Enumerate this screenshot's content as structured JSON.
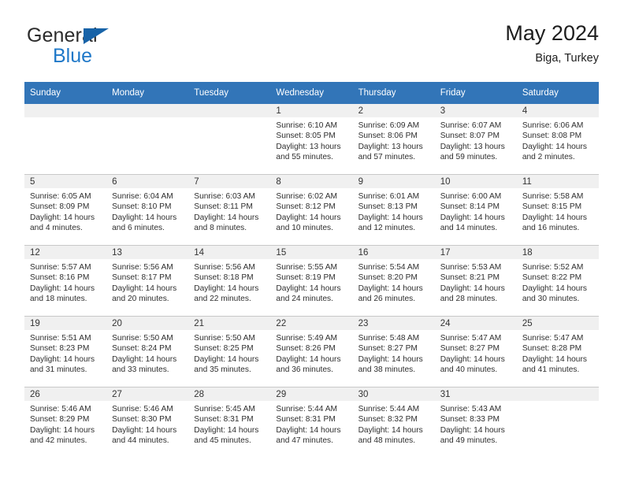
{
  "brand": {
    "name_part1": "General",
    "name_part2": "Blue",
    "triangle_icon": "triangle-icon",
    "color_primary": "#1f78c8",
    "color_triangle": "#1763a8"
  },
  "header": {
    "title": "May 2024",
    "subtitle": "Biga, Turkey"
  },
  "theme": {
    "header_bar_color": "#3275b8",
    "daynum_strip_color": "#f0f0f0",
    "grid_line_color": "#c8c8c8"
  },
  "weekdays": [
    "Sunday",
    "Monday",
    "Tuesday",
    "Wednesday",
    "Thursday",
    "Friday",
    "Saturday"
  ],
  "weeks": [
    [
      {
        "day": "",
        "empty": true
      },
      {
        "day": "",
        "empty": true
      },
      {
        "day": "",
        "empty": true
      },
      {
        "day": "1",
        "sunrise": "Sunrise: 6:10 AM",
        "sunset": "Sunset: 8:05 PM",
        "daylight": "Daylight: 13 hours and 55 minutes."
      },
      {
        "day": "2",
        "sunrise": "Sunrise: 6:09 AM",
        "sunset": "Sunset: 8:06 PM",
        "daylight": "Daylight: 13 hours and 57 minutes."
      },
      {
        "day": "3",
        "sunrise": "Sunrise: 6:07 AM",
        "sunset": "Sunset: 8:07 PM",
        "daylight": "Daylight: 13 hours and 59 minutes."
      },
      {
        "day": "4",
        "sunrise": "Sunrise: 6:06 AM",
        "sunset": "Sunset: 8:08 PM",
        "daylight": "Daylight: 14 hours and 2 minutes."
      }
    ],
    [
      {
        "day": "5",
        "sunrise": "Sunrise: 6:05 AM",
        "sunset": "Sunset: 8:09 PM",
        "daylight": "Daylight: 14 hours and 4 minutes."
      },
      {
        "day": "6",
        "sunrise": "Sunrise: 6:04 AM",
        "sunset": "Sunset: 8:10 PM",
        "daylight": "Daylight: 14 hours and 6 minutes."
      },
      {
        "day": "7",
        "sunrise": "Sunrise: 6:03 AM",
        "sunset": "Sunset: 8:11 PM",
        "daylight": "Daylight: 14 hours and 8 minutes."
      },
      {
        "day": "8",
        "sunrise": "Sunrise: 6:02 AM",
        "sunset": "Sunset: 8:12 PM",
        "daylight": "Daylight: 14 hours and 10 minutes."
      },
      {
        "day": "9",
        "sunrise": "Sunrise: 6:01 AM",
        "sunset": "Sunset: 8:13 PM",
        "daylight": "Daylight: 14 hours and 12 minutes."
      },
      {
        "day": "10",
        "sunrise": "Sunrise: 6:00 AM",
        "sunset": "Sunset: 8:14 PM",
        "daylight": "Daylight: 14 hours and 14 minutes."
      },
      {
        "day": "11",
        "sunrise": "Sunrise: 5:58 AM",
        "sunset": "Sunset: 8:15 PM",
        "daylight": "Daylight: 14 hours and 16 minutes."
      }
    ],
    [
      {
        "day": "12",
        "sunrise": "Sunrise: 5:57 AM",
        "sunset": "Sunset: 8:16 PM",
        "daylight": "Daylight: 14 hours and 18 minutes."
      },
      {
        "day": "13",
        "sunrise": "Sunrise: 5:56 AM",
        "sunset": "Sunset: 8:17 PM",
        "daylight": "Daylight: 14 hours and 20 minutes."
      },
      {
        "day": "14",
        "sunrise": "Sunrise: 5:56 AM",
        "sunset": "Sunset: 8:18 PM",
        "daylight": "Daylight: 14 hours and 22 minutes."
      },
      {
        "day": "15",
        "sunrise": "Sunrise: 5:55 AM",
        "sunset": "Sunset: 8:19 PM",
        "daylight": "Daylight: 14 hours and 24 minutes."
      },
      {
        "day": "16",
        "sunrise": "Sunrise: 5:54 AM",
        "sunset": "Sunset: 8:20 PM",
        "daylight": "Daylight: 14 hours and 26 minutes."
      },
      {
        "day": "17",
        "sunrise": "Sunrise: 5:53 AM",
        "sunset": "Sunset: 8:21 PM",
        "daylight": "Daylight: 14 hours and 28 minutes."
      },
      {
        "day": "18",
        "sunrise": "Sunrise: 5:52 AM",
        "sunset": "Sunset: 8:22 PM",
        "daylight": "Daylight: 14 hours and 30 minutes."
      }
    ],
    [
      {
        "day": "19",
        "sunrise": "Sunrise: 5:51 AM",
        "sunset": "Sunset: 8:23 PM",
        "daylight": "Daylight: 14 hours and 31 minutes."
      },
      {
        "day": "20",
        "sunrise": "Sunrise: 5:50 AM",
        "sunset": "Sunset: 8:24 PM",
        "daylight": "Daylight: 14 hours and 33 minutes."
      },
      {
        "day": "21",
        "sunrise": "Sunrise: 5:50 AM",
        "sunset": "Sunset: 8:25 PM",
        "daylight": "Daylight: 14 hours and 35 minutes."
      },
      {
        "day": "22",
        "sunrise": "Sunrise: 5:49 AM",
        "sunset": "Sunset: 8:26 PM",
        "daylight": "Daylight: 14 hours and 36 minutes."
      },
      {
        "day": "23",
        "sunrise": "Sunrise: 5:48 AM",
        "sunset": "Sunset: 8:27 PM",
        "daylight": "Daylight: 14 hours and 38 minutes."
      },
      {
        "day": "24",
        "sunrise": "Sunrise: 5:47 AM",
        "sunset": "Sunset: 8:27 PM",
        "daylight": "Daylight: 14 hours and 40 minutes."
      },
      {
        "day": "25",
        "sunrise": "Sunrise: 5:47 AM",
        "sunset": "Sunset: 8:28 PM",
        "daylight": "Daylight: 14 hours and 41 minutes."
      }
    ],
    [
      {
        "day": "26",
        "sunrise": "Sunrise: 5:46 AM",
        "sunset": "Sunset: 8:29 PM",
        "daylight": "Daylight: 14 hours and 42 minutes."
      },
      {
        "day": "27",
        "sunrise": "Sunrise: 5:46 AM",
        "sunset": "Sunset: 8:30 PM",
        "daylight": "Daylight: 14 hours and 44 minutes."
      },
      {
        "day": "28",
        "sunrise": "Sunrise: 5:45 AM",
        "sunset": "Sunset: 8:31 PM",
        "daylight": "Daylight: 14 hours and 45 minutes."
      },
      {
        "day": "29",
        "sunrise": "Sunrise: 5:44 AM",
        "sunset": "Sunset: 8:31 PM",
        "daylight": "Daylight: 14 hours and 47 minutes."
      },
      {
        "day": "30",
        "sunrise": "Sunrise: 5:44 AM",
        "sunset": "Sunset: 8:32 PM",
        "daylight": "Daylight: 14 hours and 48 minutes."
      },
      {
        "day": "31",
        "sunrise": "Sunrise: 5:43 AM",
        "sunset": "Sunset: 8:33 PM",
        "daylight": "Daylight: 14 hours and 49 minutes."
      },
      {
        "day": "",
        "empty": true
      }
    ]
  ]
}
